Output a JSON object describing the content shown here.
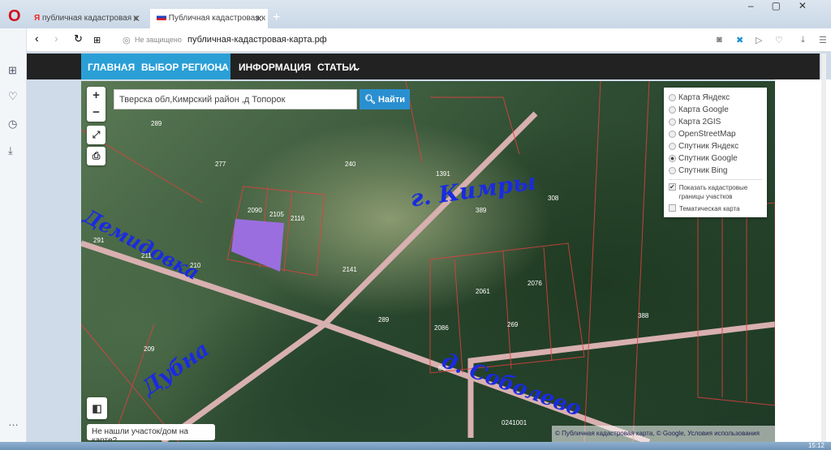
{
  "browser": {
    "tabs": [
      {
        "label": "публичная кадастровая к",
        "icon": "yandex-icon"
      },
      {
        "label": "Публичная кадастровая к",
        "icon": "flag-icon"
      }
    ],
    "security": "Не защищено",
    "url": "публичная-кадастровая-карта.рф"
  },
  "nav": {
    "items": [
      "ГЛАВНАЯ",
      "ВЫБОР РЕГИОНА",
      "ИНФОРМАЦИЯ",
      "СТАТЬИ"
    ]
  },
  "map": {
    "search_value": "Тверска обл,Кимрский район ,д Топорок",
    "search_button": "Найти",
    "layers": [
      "Карта Яндекс",
      "Карта Google",
      "Карта 2GIS",
      "OpenStreetMap",
      "Спутник Яндекс",
      "Спутник Google",
      "Спутник Bing"
    ],
    "selected_layer": "Спутник Google",
    "show_borders": "Показать кадастровые границы участков",
    "show_borders_checked": true,
    "thematic": "Тематическая карта",
    "thematic_checked": false,
    "not_found": "Не нашли участок/дом на карте?",
    "attribution": "© Публичная кадастровая карта, © Google, Условия использования",
    "labels": [
      "289",
      "277",
      "240",
      "1391",
      "308",
      "389",
      "211",
      "210",
      "291",
      "209",
      "388",
      "289",
      "2090",
      "2105",
      "2116",
      "2141",
      "2061",
      "2076",
      "2086",
      "269",
      "86",
      "0241001"
    ],
    "annotations": [
      "Демидовка",
      "г. Кимры",
      "Дубна",
      "д. Соболево"
    ]
  },
  "taskbar": {
    "time": "15:12"
  }
}
